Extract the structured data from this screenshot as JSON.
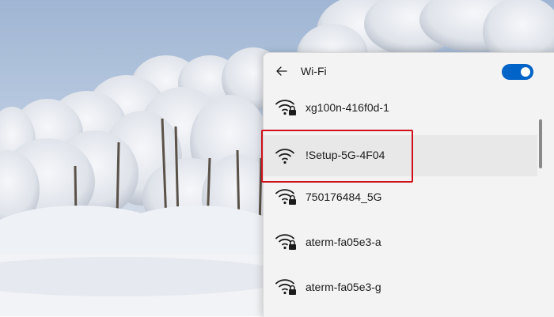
{
  "wifi_panel": {
    "title": "Wi-Fi",
    "back_icon": "back-arrow-icon",
    "toggle_on": true,
    "accent_color": "#0063c8",
    "networks": [
      {
        "ssid": "xg100n-416f0d-1",
        "secured": true,
        "icon": "wifi-secured-icon"
      },
      {
        "ssid": "!Setup-5G-4F04",
        "secured": false,
        "icon": "wifi-icon"
      },
      {
        "ssid": "750176484_5G",
        "secured": true,
        "icon": "wifi-secured-icon"
      },
      {
        "ssid": "aterm-fa05e3-a",
        "secured": true,
        "icon": "wifi-secured-icon"
      },
      {
        "ssid": "aterm-fa05e3-g",
        "secured": true,
        "icon": "wifi-secured-icon"
      }
    ]
  },
  "annotation": {
    "highlight_color": "#d0101a",
    "highlighted_network": "!Setup-5G-4F04"
  }
}
